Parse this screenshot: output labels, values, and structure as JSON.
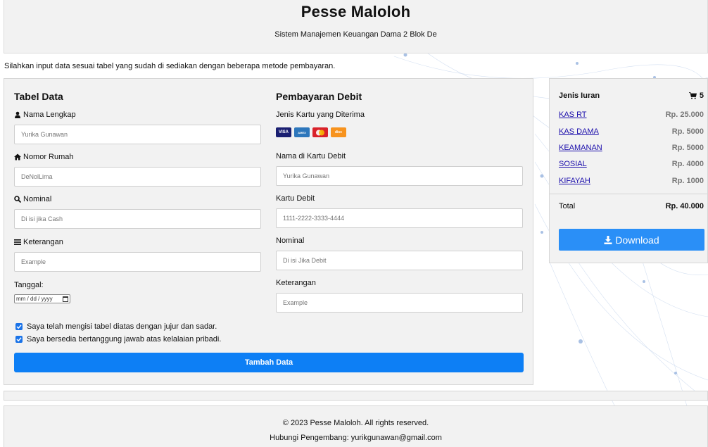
{
  "header": {
    "title": "Pesse Maloloh",
    "subtitle": "Sistem Manajemen Keuangan Dama 2 Blok De"
  },
  "intro_text": "Silahkan input data sesuai tabel yang sudah di sediakan dengan beberapa metode pembayaran.",
  "left_form": {
    "heading": "Tabel Data",
    "nama_label": "Nama Lengkap",
    "nama_placeholder": "Yurika Gunawan",
    "rumah_label": "Nomor Rumah",
    "rumah_placeholder": "DeNolLima",
    "nominal_label": "Nominal",
    "nominal_placeholder": "Di isi jika Cash",
    "keterangan_label": "Keterangan",
    "keterangan_placeholder": "Example",
    "tanggal_label": "Tanggal:",
    "date_placeholder": "mm / dd / yyyy"
  },
  "right_form": {
    "heading": "Pembayaran Debit",
    "cards_label": "Jenis Kartu yang Diterima",
    "cards": [
      {
        "name": "visa-card-icon",
        "text": "VISA",
        "color": "#1a1f71"
      },
      {
        "name": "amex-card-icon",
        "text": "AMEX",
        "color": "#2e77bc"
      },
      {
        "name": "mastercard-icon",
        "text": "",
        "color": "#d9222a"
      },
      {
        "name": "discover-card-icon",
        "text": "disc",
        "color": "#f7931e"
      }
    ],
    "nama_kartu_label": "Nama di Kartu Debit",
    "nama_kartu_placeholder": "Yurika Gunawan",
    "kartu_label": "Kartu Debit",
    "kartu_placeholder": "1111-2222-3333-4444",
    "nominal_label": "Nominal",
    "nominal_placeholder": "Di isi Jika Debit",
    "keterangan_label": "Keterangan",
    "keterangan_placeholder": "Example"
  },
  "checks": {
    "c1": "Saya telah mengisi tabel diatas dengan jujur dan sadar.",
    "c2": "Saya bersedia bertanggung jawab atas kelalaian pribadi."
  },
  "submit_label": "Tambah Data",
  "side": {
    "title": "Jenis Iuran",
    "cart_count": "5",
    "items": [
      {
        "label": "KAS RT",
        "amount": "Rp. 25.000"
      },
      {
        "label": "KAS DAMA",
        "amount": "Rp. 5000"
      },
      {
        "label": "KEAMANAN",
        "amount": "Rp. 5000"
      },
      {
        "label": "SOSIAL",
        "amount": "Rp. 4000"
      },
      {
        "label": "KIFAYAH",
        "amount": "Rp. 1000"
      }
    ],
    "total_label": "Total",
    "total_amount": "Rp. 40.000",
    "download_label": "Download"
  },
  "footer": {
    "copyright": "© 2023 Pesse Maloloh. All rights reserved.",
    "contact": "Hubungi Pengembang: yurikgunawan@gmail.com"
  },
  "colors": {
    "primary": "#0d7ff5",
    "download": "#2a8ff7",
    "link": "#1a0dab",
    "panel": "#f2f2f2"
  }
}
